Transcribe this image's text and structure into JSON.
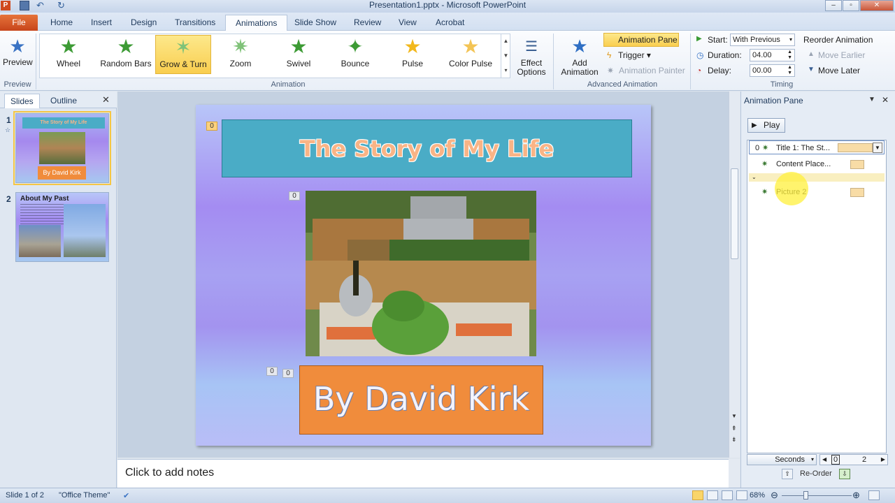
{
  "window": {
    "title": "Presentation1.pptx - Microsoft PowerPoint"
  },
  "tabs": [
    {
      "label": "File"
    },
    {
      "label": "Home"
    },
    {
      "label": "Insert"
    },
    {
      "label": "Design"
    },
    {
      "label": "Transitions"
    },
    {
      "label": "Animations"
    },
    {
      "label": "Slide Show"
    },
    {
      "label": "Review"
    },
    {
      "label": "View"
    },
    {
      "label": "Acrobat"
    }
  ],
  "ribbon": {
    "preview_label": "Preview",
    "preview_group": "Preview",
    "animation_items": [
      {
        "label": "Wheel"
      },
      {
        "label": "Random Bars"
      },
      {
        "label": "Grow & Turn"
      },
      {
        "label": "Zoom"
      },
      {
        "label": "Swivel"
      },
      {
        "label": "Bounce"
      },
      {
        "label": "Pulse"
      },
      {
        "label": "Color Pulse"
      }
    ],
    "effect_options_line1": "Effect",
    "effect_options_line2": "Options",
    "animation_group": "Animation",
    "add_animation_line1": "Add",
    "add_animation_line2": "Animation",
    "animation_pane": "Animation Pane",
    "trigger": "Trigger",
    "animation_painter": "Animation Painter",
    "advanced_group": "Advanced Animation",
    "start_label": "Start:",
    "start_value": "With Previous",
    "duration_label": "Duration:",
    "duration_value": "04.00",
    "delay_label": "Delay:",
    "delay_value": "00.00",
    "reorder": "Reorder Animation",
    "move_earlier": "Move Earlier",
    "move_later": "Move Later",
    "timing_group": "Timing"
  },
  "left_pane": {
    "tab_slides": "Slides",
    "tab_outline": "Outline",
    "slides": [
      {
        "number": "1",
        "title": "The Story of My Life",
        "subtitle": "By David Kirk"
      },
      {
        "number": "2",
        "title": "About My Past"
      }
    ]
  },
  "slide": {
    "title": "The Story of My Life",
    "author": "By David Kirk",
    "tags": {
      "title": "0",
      "picture": "0",
      "author_a": "0",
      "author_b": "0"
    }
  },
  "notes": {
    "placeholder": "Click to add notes"
  },
  "animation_pane": {
    "header": "Animation Pane",
    "play": "Play",
    "items": [
      {
        "index": "0",
        "label": "Title 1: The St..."
      },
      {
        "index": "",
        "label": "Content Place..."
      },
      {
        "index": "",
        "label": "Picture 2"
      }
    ],
    "seconds": "Seconds",
    "timeline_0": "0",
    "timeline_2": "2",
    "reorder": "Re-Order"
  },
  "statusbar": {
    "slide_info": "Slide 1 of 2",
    "theme": "\"Office Theme\"",
    "zoom": "68%"
  },
  "colors": {
    "accent": "#f5c644",
    "file_tab": "#c7451b",
    "title_fill": "#4aacc6",
    "author_fill": "#f08c3c"
  }
}
